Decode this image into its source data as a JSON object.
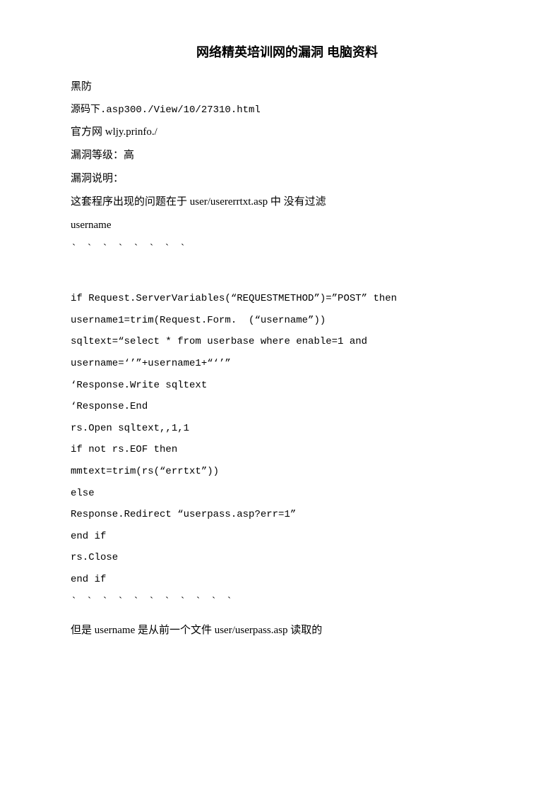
{
  "page": {
    "title": "网络精英培训网的漏洞  电脑资料",
    "source_label": "黑防",
    "source_url": "源码下.asp300./View/10/27310.html",
    "official_site": "官方网 wljy.prinfo./",
    "vuln_level_label": "漏洞等级：高",
    "vuln_desc_label": "漏洞说明：",
    "vuln_desc_text": "这套程序出现的问题在于 user/usererrtxt.asp 中  没有过滤",
    "username_label": "username",
    "dots1": "` ` ` ` ` ` ` `",
    "code_lines": [
      "",
      "if Request.ServerVariables(\"REQUESTMETHOD\")=\"POST\" then",
      "username1=trim(Request.Form.  (\"username\"))",
      "sqltext=\"select * from userbase where enable=1 and",
      "username=''\"+username1+\"''\"",
      "'Response.Write sqltext",
      "'Response.End",
      "rs.Open sqltext,,1,1",
      "if not rs.EOF then",
      "mmtext=trim(rs(\"errtxt\"))",
      "else",
      "Response.Redirect \"userpass.asp?err=1\"",
      "end if",
      "rs.Close",
      "end if"
    ],
    "dots2": "` ` ` ` ` ` ` ` ` ` `",
    "footer_text": "但是 username 是从前一个文件 user/userpass.asp 读取的"
  }
}
